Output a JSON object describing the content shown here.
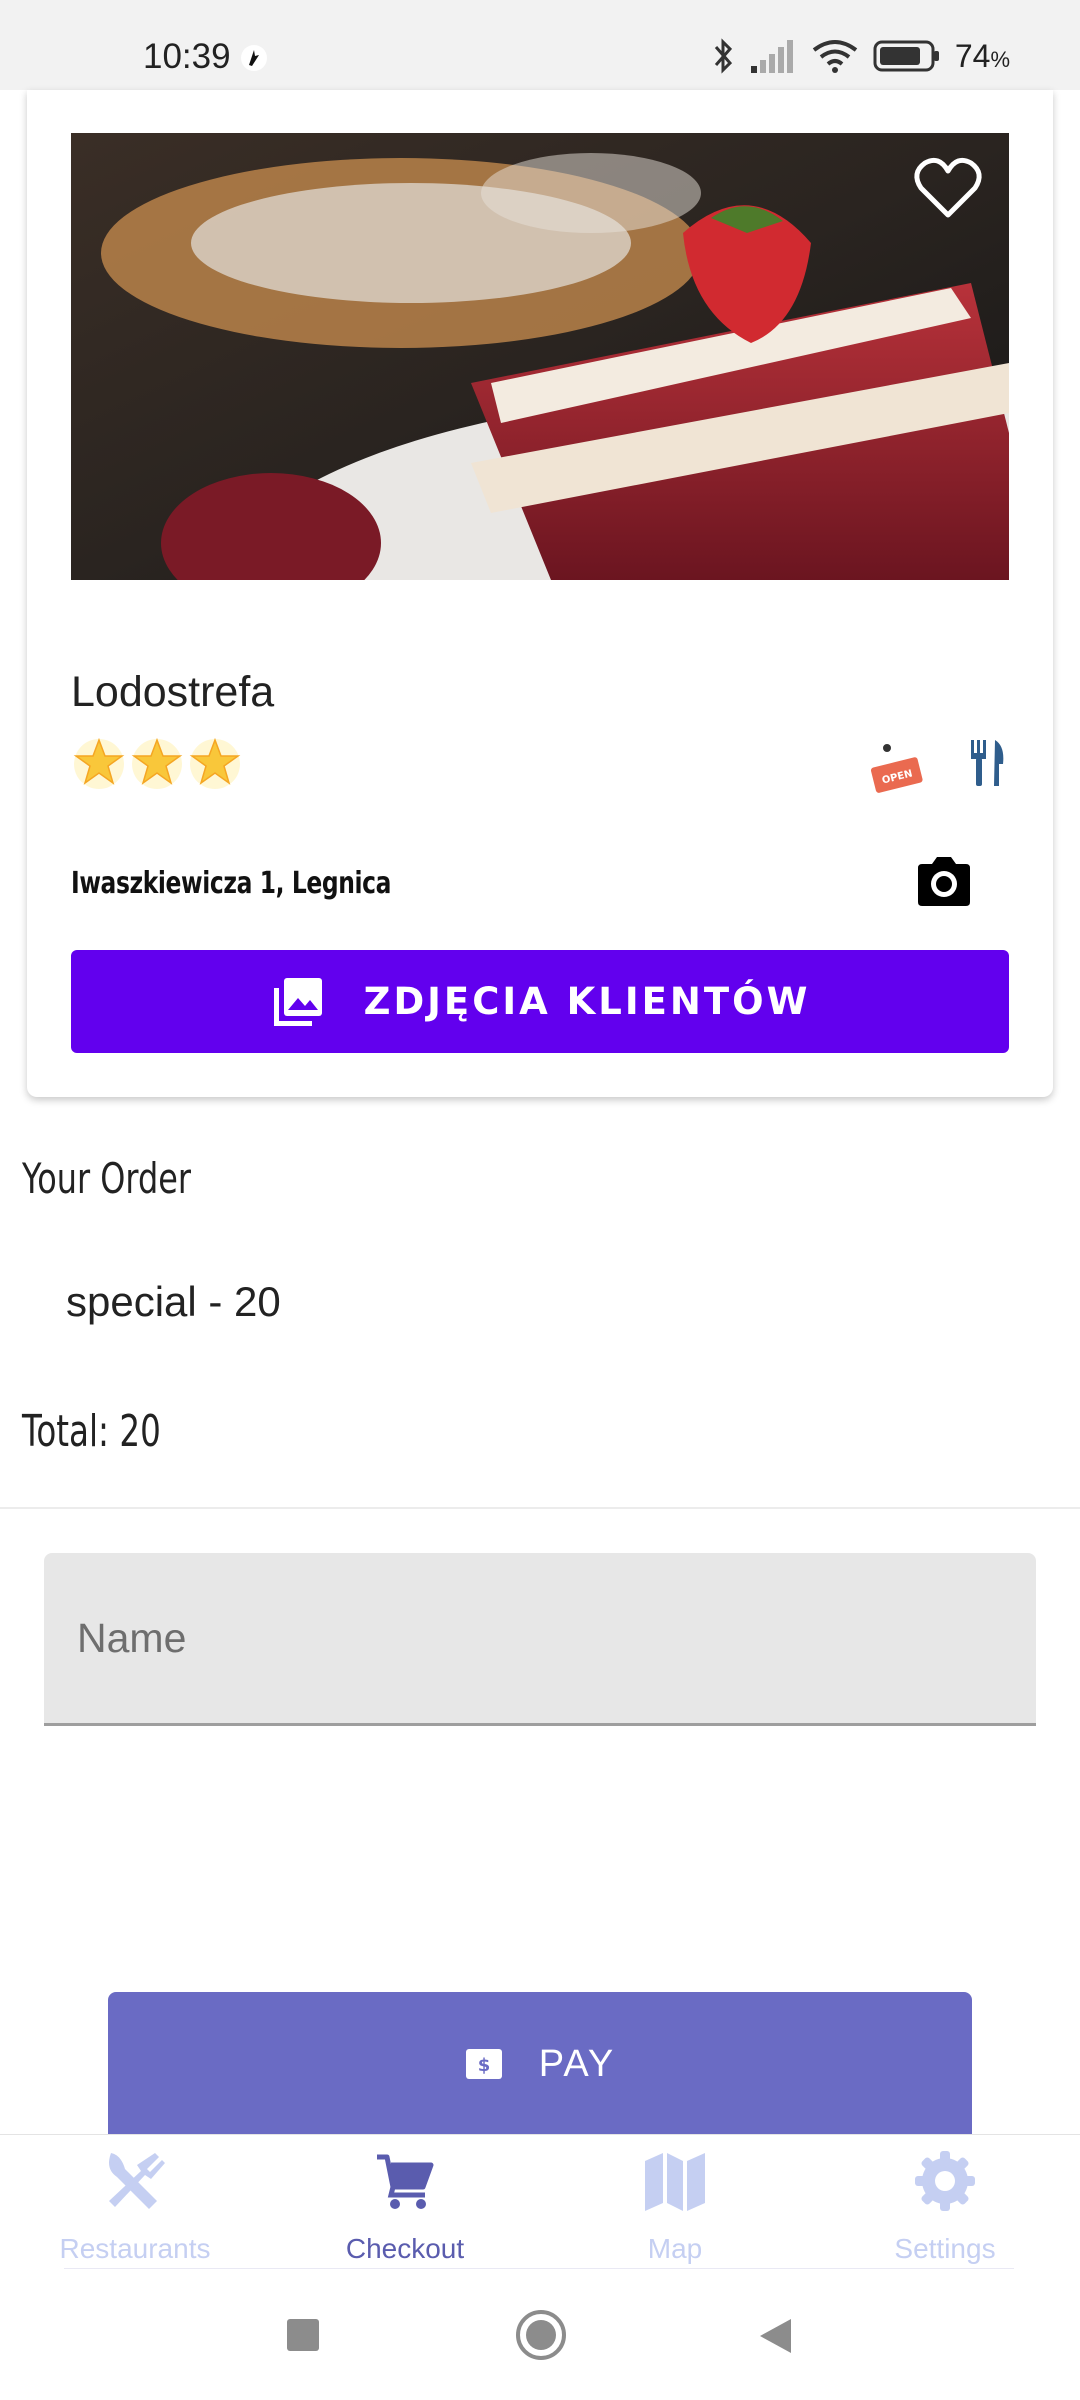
{
  "status_bar": {
    "time": "10:39",
    "battery_percent": "74",
    "battery_unit": "%",
    "icons": [
      "notification-app-icon",
      "bluetooth-icon",
      "signal-icon",
      "wifi-icon",
      "battery-icon"
    ]
  },
  "restaurant": {
    "name": "Lodostrefa",
    "rating_stars": 3,
    "address": "Iwaszkiewicza 1, Legnica",
    "favorite": false,
    "photos_button_label": "ZDJĘCIA KLIENTÓW",
    "status_badge": "OPEN"
  },
  "order": {
    "title": "Your Order",
    "items": [
      {
        "label": "special - 20"
      }
    ],
    "total_label": "Total: 20"
  },
  "form": {
    "name_placeholder": "Name",
    "name_value": ""
  },
  "pay_button_label": "PAY",
  "bottom_nav": {
    "items": [
      {
        "label": "Restaurants",
        "icon": "utensils-crossed-icon",
        "active": false
      },
      {
        "label": "Checkout",
        "icon": "cart-icon",
        "active": true
      },
      {
        "label": "Map",
        "icon": "map-icon",
        "active": false
      },
      {
        "label": "Settings",
        "icon": "gear-icon",
        "active": false
      }
    ]
  },
  "colors": {
    "primary_button": "#6200ee",
    "pay_button": "#6a6bc4",
    "nav_active": "#5a5cae",
    "nav_inactive": "#c5cff2",
    "star": "#f9c73a"
  }
}
